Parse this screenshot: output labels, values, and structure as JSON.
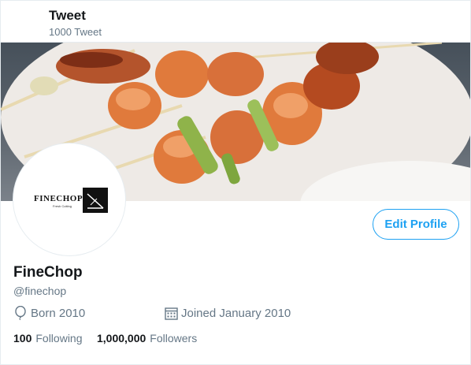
{
  "header": {
    "title": "Tweet",
    "tweet_count": "1000 Tweet"
  },
  "banner": {
    "description_icon": "food-photo"
  },
  "avatar": {
    "logo_text": "FINECHOP",
    "logo_subtext": "Fresh Cutting"
  },
  "profile": {
    "edit_button": "Edit Profile",
    "display_name": "FineChop",
    "handle": "@finechop",
    "born": "Born 2010",
    "joined": "Joined January 2010"
  },
  "stats": {
    "following_count": "100",
    "following_label": "Following",
    "followers_count": "1,000,000",
    "followers_label": "Followers"
  },
  "colors": {
    "accent": "#1da1f2",
    "muted": "#657786",
    "text": "#14171a"
  }
}
